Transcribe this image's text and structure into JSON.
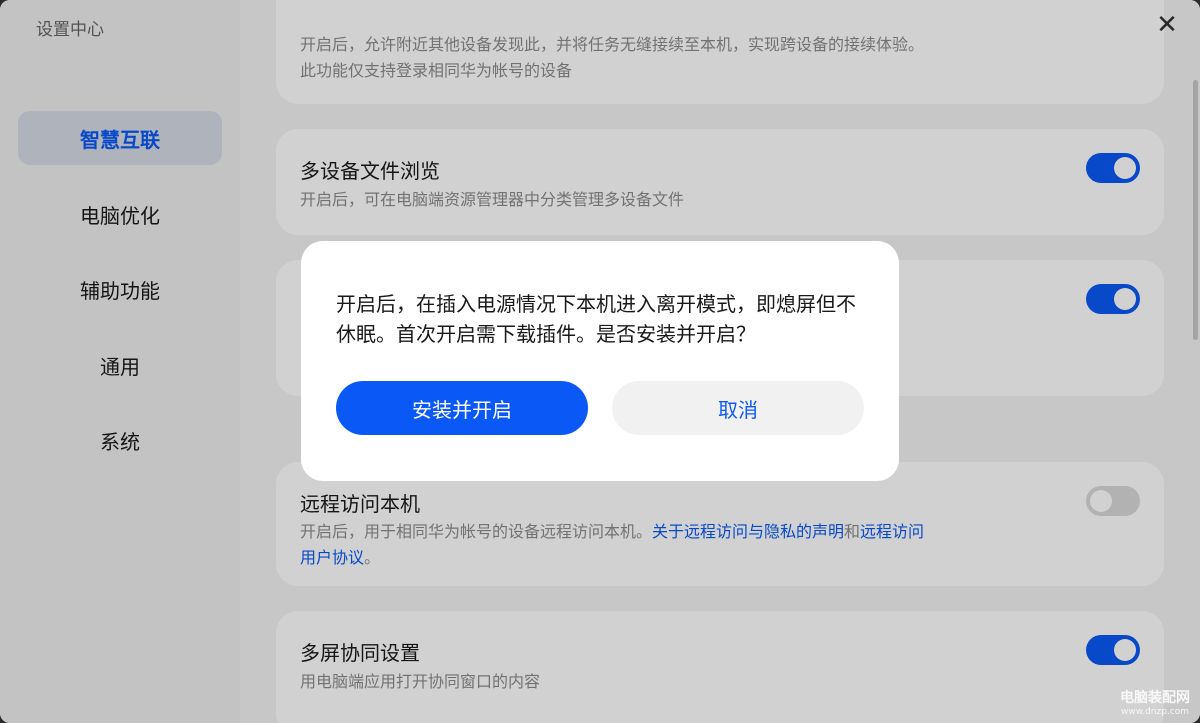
{
  "window": {
    "title": "设置中心"
  },
  "sidebar": {
    "items": [
      {
        "label": "智慧互联",
        "active": true
      },
      {
        "label": "电脑优化",
        "active": false
      },
      {
        "label": "辅助功能",
        "active": false
      },
      {
        "label": "通用",
        "active": false
      },
      {
        "label": "系统",
        "active": false
      }
    ]
  },
  "cards": {
    "top_partial": {
      "desc_line1": "开启后，允许附近其他设备发现此，并将任务无缝接续至本机，实现跨设备的接续体验。",
      "desc_line2": "此功能仅支持登录相同华为帐号的设备"
    },
    "multi_device_files": {
      "title": "多设备文件浏览",
      "desc": "开启后，可在电脑端资源管理器中分类管理多设备文件",
      "toggle": "on"
    },
    "hidden_behind_dialog": {
      "toggle": "on"
    },
    "remote_access": {
      "title": "远程访问本机",
      "desc_prefix": "开启后，用于相同华为帐号的设备远程访问本机。",
      "link1": "关于远程访问与隐私的声明",
      "and": "和",
      "link2_line1": "远程访问",
      "link2_line2": "用户协议",
      "suffix": "。",
      "toggle": "off"
    },
    "multi_screen": {
      "title": "多屏协同设置",
      "desc": "用电脑端应用打开协同窗口的内容",
      "toggle": "on"
    }
  },
  "dialog": {
    "message": "开启后，在插入电源情况下本机进入离开模式，即熄屏但不休眠。首次开启需下载插件。是否安装并开启？",
    "confirm_label": "安装并开启",
    "cancel_label": "取消"
  },
  "watermark": {
    "line1": "电脑装配网",
    "line2": "www.dnzp.com"
  },
  "colors": {
    "accent": "#0a59f7",
    "sidebar_active_bg": "#d6dbe6",
    "card_bg": "#ffffff",
    "page_bg": "#f3f3f3"
  }
}
